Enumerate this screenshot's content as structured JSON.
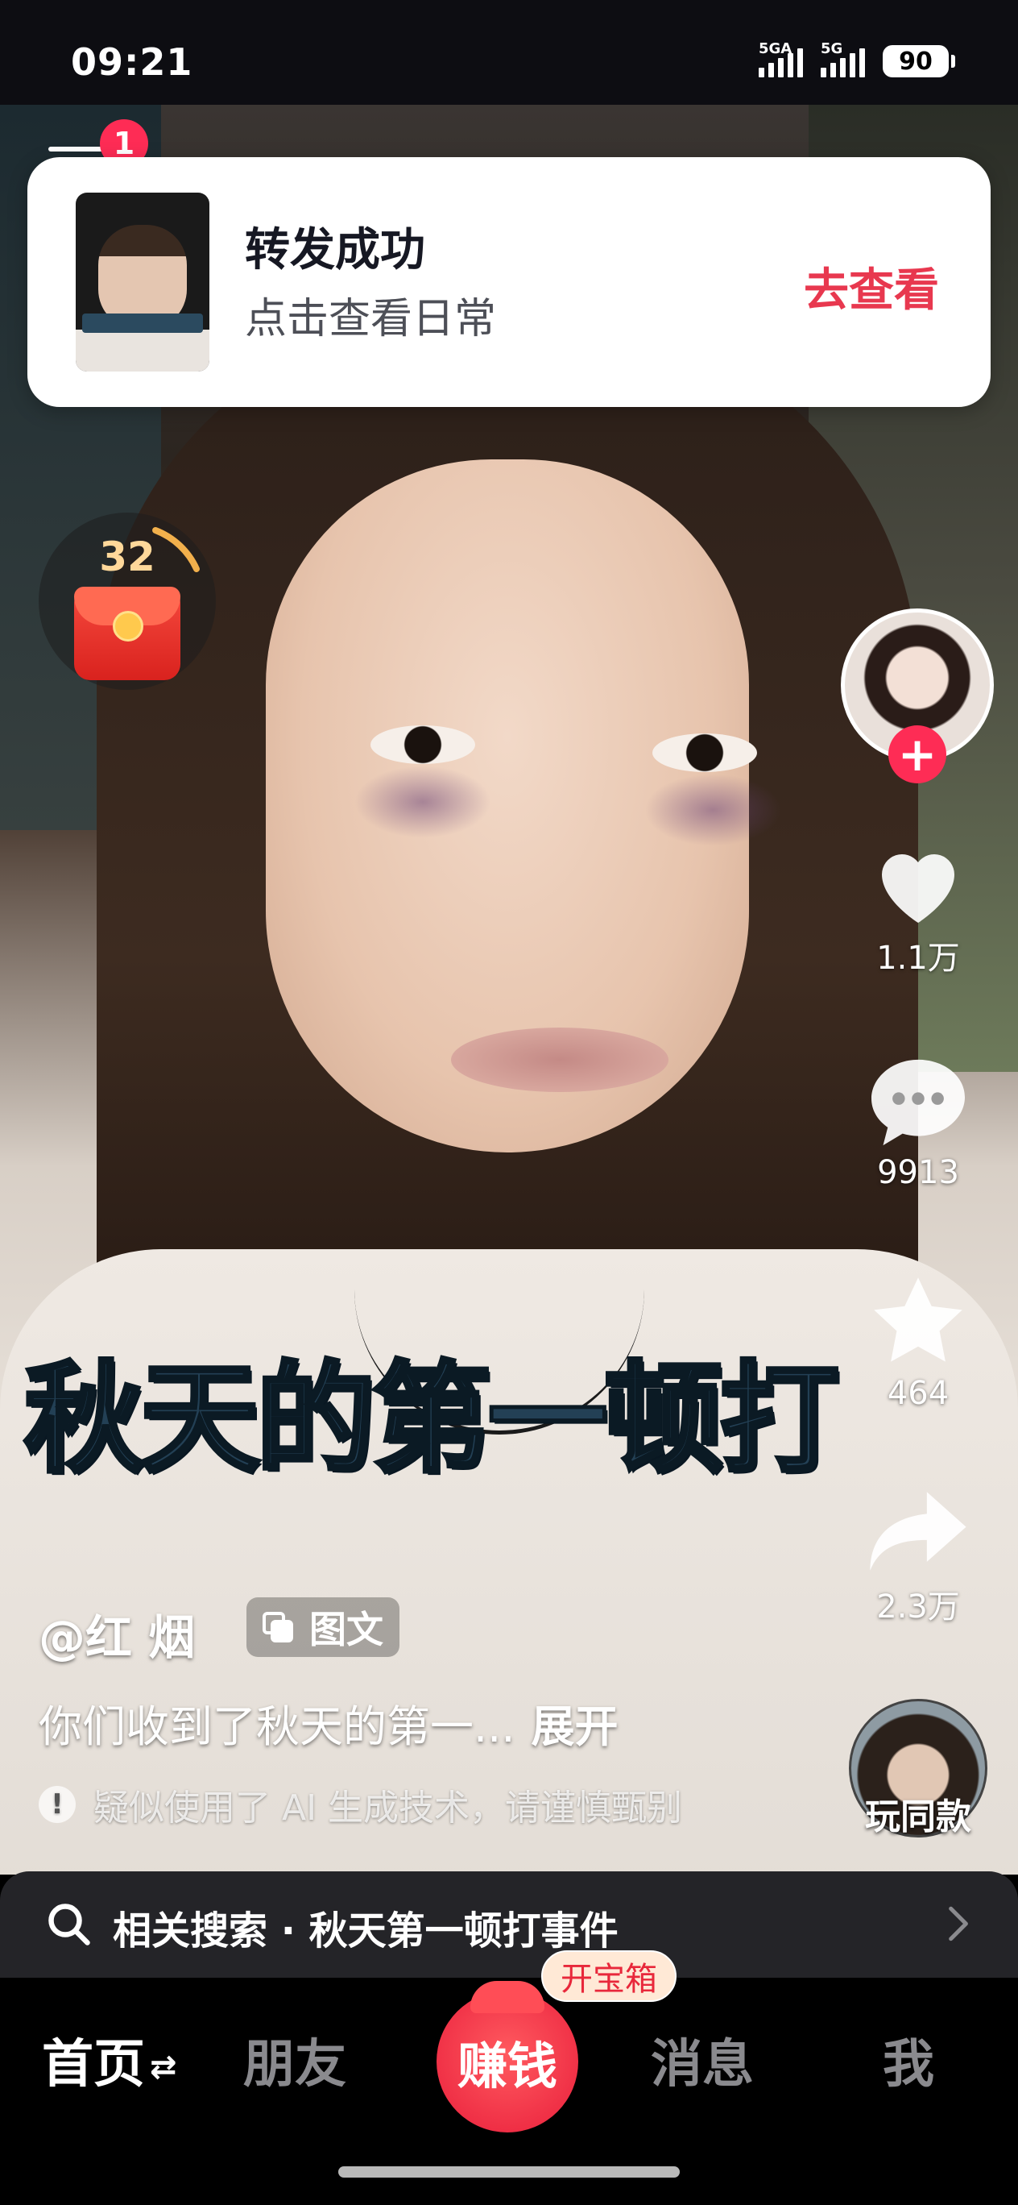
{
  "status_bar": {
    "time": "09:21",
    "signal1_label": "5GA",
    "signal2_label": "5G",
    "battery": "90"
  },
  "top_nav": {
    "notification_count": "1"
  },
  "toast": {
    "title": "转发成功",
    "subtitle": "点击查看日常",
    "action": "去查看"
  },
  "red_packet": {
    "countdown": "32"
  },
  "video": {
    "overlay_text": "秋天的第一顿打"
  },
  "actions": {
    "likes": "1.1万",
    "comments": "9913",
    "favorites": "464",
    "shares": "2.3万",
    "remix_label": "玩同款"
  },
  "post": {
    "author": "@红 烟",
    "type_tag": "图文",
    "description": "你们收到了秋天的第一...",
    "expand_label": "展开",
    "ai_notice": "疑似使用了 AI 生成技术，请谨慎甄别"
  },
  "related_search": {
    "text": "相关搜索 · 秋天第一顿打事件"
  },
  "tab_bar": {
    "home": "首页",
    "home_switch": "⇄",
    "friends": "朋友",
    "earn": "赚钱",
    "earn_badge": "开宝箱",
    "messages": "消息",
    "me": "我"
  },
  "colors": {
    "accent": "#fe2c55",
    "toast_action": "#e8384f",
    "caption": "#234055"
  }
}
